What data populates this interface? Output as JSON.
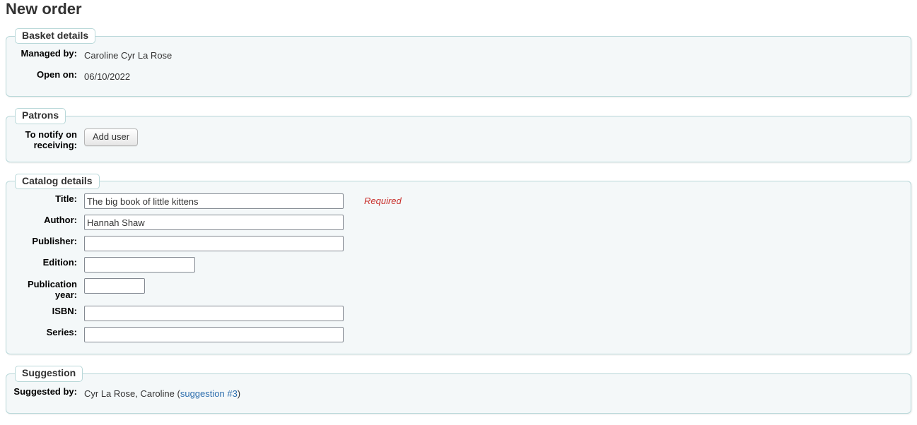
{
  "page": {
    "title": "New order"
  },
  "basket": {
    "legend": "Basket details",
    "managed_by_label": "Managed by:",
    "managed_by_value": "Caroline Cyr La Rose",
    "open_on_label": "Open on:",
    "open_on_value": "06/10/2022"
  },
  "patrons": {
    "legend": "Patrons",
    "notify_label": "To notify on receiving:",
    "add_user_button": "Add user"
  },
  "catalog": {
    "legend": "Catalog details",
    "fields": [
      {
        "label": "Title:",
        "value": "The big book of little kittens",
        "placeholder": "",
        "hint": "Required",
        "width": "wide"
      },
      {
        "label": "Author:",
        "value": "Hannah Shaw",
        "placeholder": "",
        "hint": "",
        "width": "wide"
      },
      {
        "label": "Publisher:",
        "value": "",
        "placeholder": "",
        "hint": "",
        "width": "wide"
      },
      {
        "label": "Edition:",
        "value": "",
        "placeholder": "",
        "hint": "",
        "width": "mid"
      },
      {
        "label": "Publication year:",
        "value": "",
        "placeholder": "",
        "hint": "",
        "width": "small"
      },
      {
        "label": "ISBN:",
        "value": "",
        "placeholder": "",
        "hint": "",
        "width": "wide"
      },
      {
        "label": "Series:",
        "value": "",
        "placeholder": "",
        "hint": "",
        "width": "wide"
      }
    ]
  },
  "suggestion": {
    "legend": "Suggestion",
    "suggested_by_label": "Suggested by:",
    "suggested_by_name": "Cyr La Rose, Caroline",
    "paren_open": " (",
    "link_text": "suggestion #3",
    "paren_close": ")"
  },
  "colors": {
    "fieldset_border": "#b9d8d9",
    "fieldset_background": "#f4f8f9",
    "link": "#2b6dad",
    "required": "#c9302c",
    "input_border": "#848a92"
  }
}
